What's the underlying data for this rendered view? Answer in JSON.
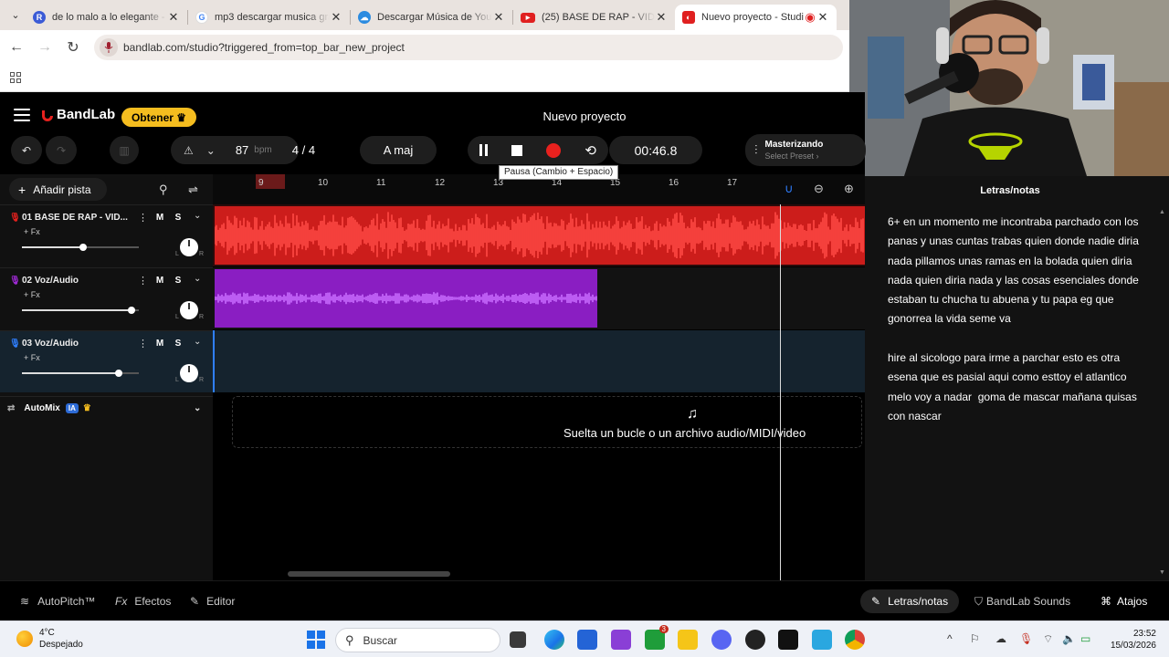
{
  "browser": {
    "tabs": [
      {
        "title": "de lo malo a lo elegante - F",
        "favicon": "R",
        "color": "#3b5bd6"
      },
      {
        "title": "mp3 descargar musica gra",
        "favicon": "G",
        "color": "#ffffff"
      },
      {
        "title": "Descargar Música de YouT",
        "favicon": "",
        "color": "#2b8be0"
      },
      {
        "title": "(25) BASE DE RAP - VIDA M",
        "favicon": "",
        "color": "#e02020"
      },
      {
        "title": "Nuevo proyecto - Studi",
        "favicon": "",
        "color": "#e02020"
      }
    ],
    "url": "bandlab.com/studio?triggered_from=top_bar_new_project"
  },
  "app": {
    "brand": "BandLab",
    "get_button": "Obtener",
    "project_title": "Nuevo proyecto",
    "bpm_value": "87",
    "bpm_unit": "bpm",
    "time_signature_num": "4",
    "time_signature_sep": "/",
    "time_signature_den": "4",
    "key": "A maj",
    "time_display": "00:46.8",
    "pause_tooltip": "Pausa (Cambio + Espacio)",
    "master_label": "Masterizando",
    "master_preset": "Select Preset",
    "add_track": "Añadir pista",
    "ruler_ticks": [
      "9",
      "10",
      "11",
      "12",
      "13",
      "14",
      "15",
      "16",
      "17"
    ],
    "tracks": [
      {
        "name": "01  BASE DE RAP - VID...",
        "fx": "+ Fx",
        "volume": 0.52,
        "mic_color": "#e8211e"
      },
      {
        "name": "02  Voz/Audio",
        "fx": "+ Fx",
        "volume": 0.94,
        "mic_color": "#a02ad6"
      },
      {
        "name": "03  Voz/Audio",
        "fx": "+ Fx",
        "volume": 0.83,
        "mic_color": "#2f7fff"
      }
    ],
    "mute_label": "M",
    "solo_label": "S",
    "automix_label": "AutoMix",
    "ia_badge": "IA",
    "drop_text": "Suelta un bucle o un archivo audio/MIDI/video",
    "lyrics_title": "Letras/notas",
    "lyrics_text": "6+ en un momento me incontraba parchado con los panas y unas cuntas trabas quien donde nadie diria nada pillamos unas ramas en la bolada quien diria nada quien diria nada y las cosas esenciales donde estaban tu chucha tu abuena y tu papa eg que gonorrea la vida seme va\n\nhire al sicologo para irme a parchar esto es otra esena que es pasial aqui como esttoy el atlantico melo voy a nadar  goma de mascar mañana quisas con nascar",
    "bottom": {
      "autopitch": "AutoPitch™",
      "effects": "Efectos",
      "editor": "Editor",
      "lyrics": "Letras/notas",
      "sounds": "BandLab Sounds",
      "shortcuts": "Atajos"
    },
    "colors": {
      "accent_yellow": "#f5bd1f",
      "track1": "#cc1d1b",
      "track2": "#8a1ec2",
      "track3_select": "#2f7fff"
    }
  },
  "taskbar": {
    "temp": "4°C",
    "weather": "Despejado",
    "search": "Buscar",
    "time": "23:52",
    "date": "15/03/2026",
    "badge_count": "3"
  }
}
